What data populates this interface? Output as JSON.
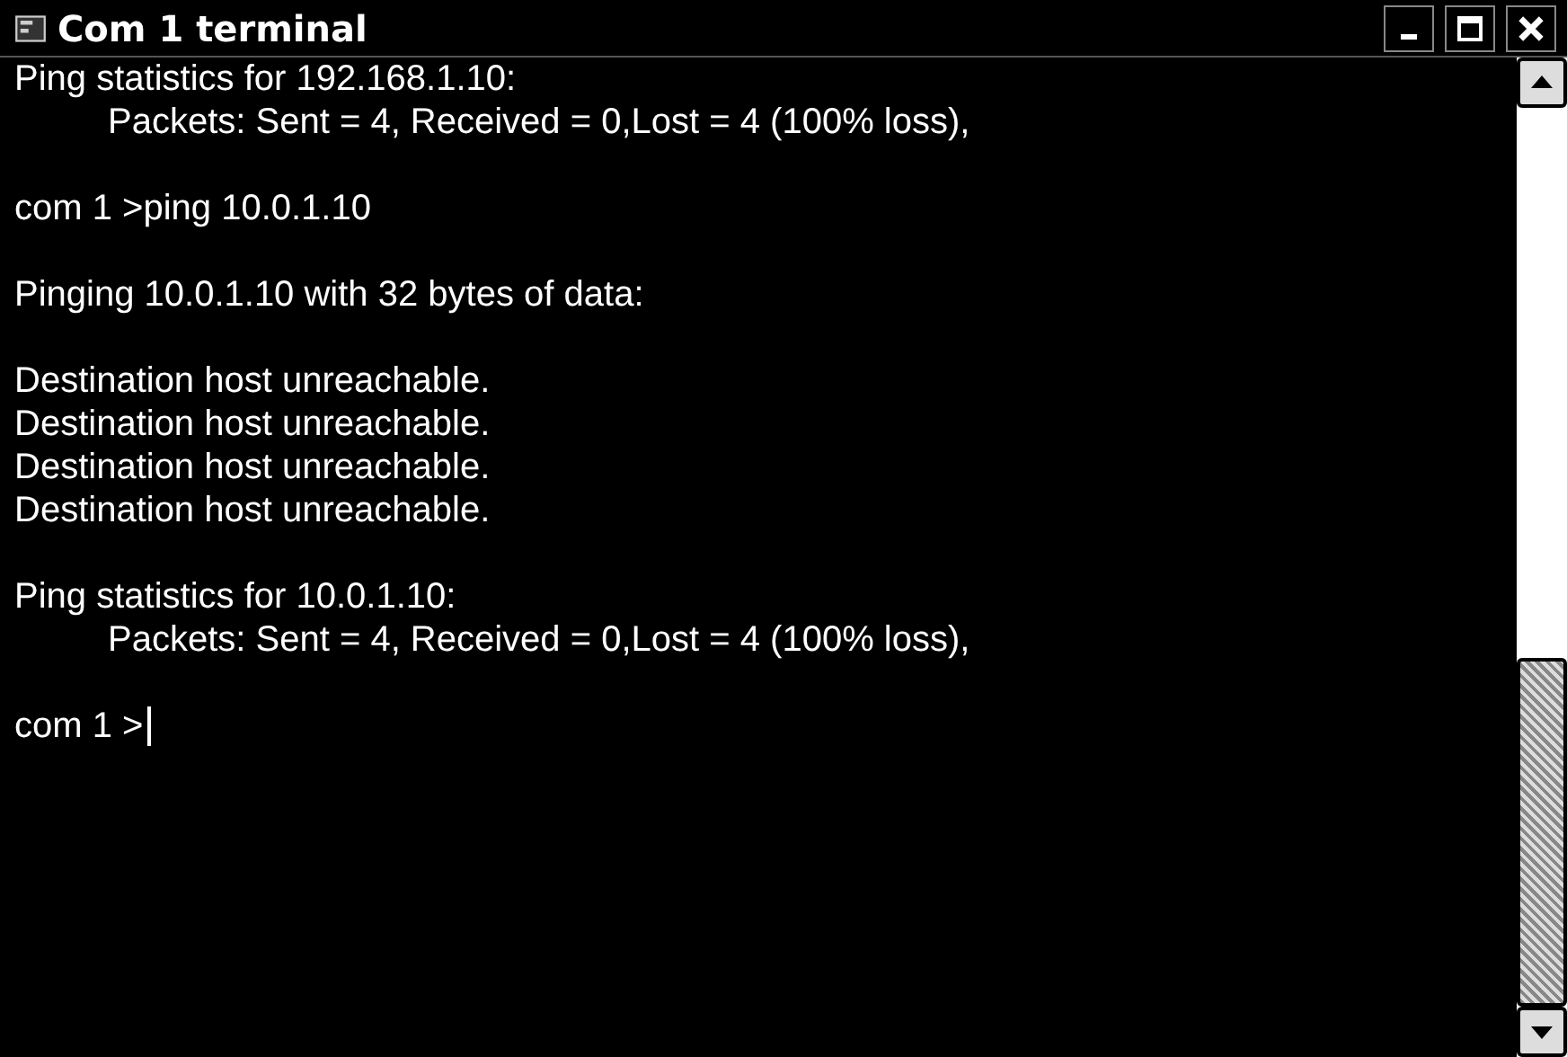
{
  "window": {
    "title": "Com 1 terminal"
  },
  "terminal": {
    "blocks": [
      [
        {
          "kind": "text",
          "text": "Ping statistics for 192.168.1.10:"
        },
        {
          "kind": "indented",
          "text": "Packets: Sent = 4, Received = 0,Lost = 4 (100% loss),"
        }
      ],
      [
        {
          "kind": "text",
          "text": "com 1 >ping 10.0.1.10"
        }
      ],
      [
        {
          "kind": "text",
          "text": "Pinging 10.0.1.10 with 32 bytes of data:"
        }
      ],
      [
        {
          "kind": "text",
          "text": "Destination host unreachable."
        },
        {
          "kind": "text",
          "text": "Destination host unreachable."
        },
        {
          "kind": "text",
          "text": "Destination host unreachable."
        },
        {
          "kind": "text",
          "text": "Destination host unreachable."
        }
      ],
      [
        {
          "kind": "text",
          "text": "Ping statistics for 10.0.1.10:"
        },
        {
          "kind": "indented",
          "text": "Packets: Sent = 4, Received = 0,Lost = 4 (100% loss),"
        }
      ],
      [
        {
          "kind": "input",
          "text": "com 1 >"
        }
      ]
    ]
  }
}
